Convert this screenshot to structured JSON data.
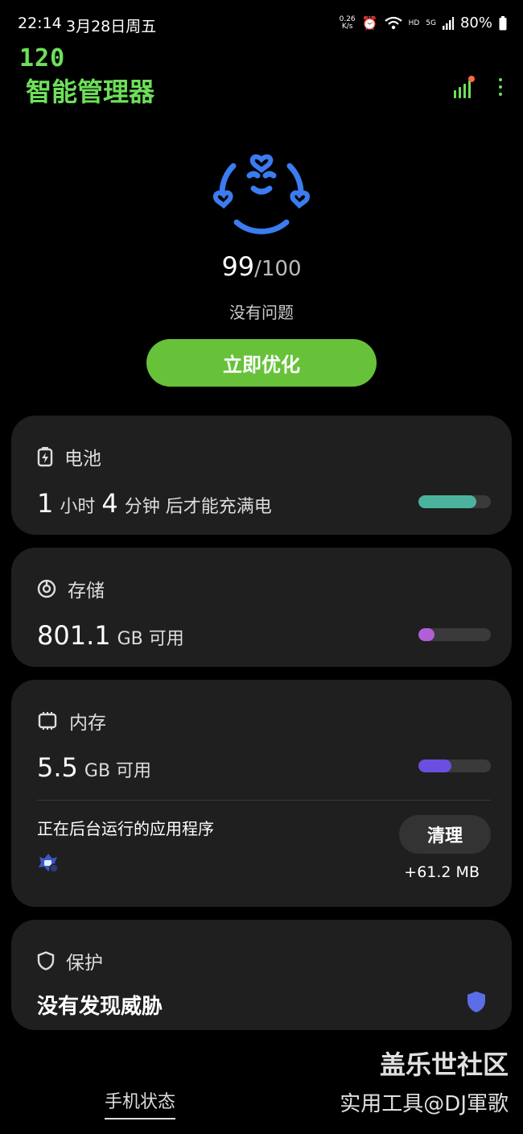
{
  "status_bar": {
    "time": "22:14",
    "date": "3月28日周五",
    "net_speed_value": "0.26",
    "net_speed_unit": "K/s",
    "hd": "HD",
    "network": "5G",
    "battery": "80%"
  },
  "overlay": {
    "fps": "120"
  },
  "header": {
    "title": "智能管理器"
  },
  "summary": {
    "score": "99",
    "score_max": "/100",
    "status": "没有问题",
    "optimize_label": "立即优化"
  },
  "battery_card": {
    "title": "电池",
    "hours": "1",
    "hours_unit": "小时",
    "minutes": "4",
    "minutes_unit": "分钟 后才能充满电",
    "level_fraction": 0.8,
    "bar_color": "#4bb39d"
  },
  "storage_card": {
    "title": "存储",
    "value": "801.1",
    "unit": "GB 可用",
    "level_fraction": 0.22,
    "bar_color": "#b15fd6"
  },
  "memory_card": {
    "title": "内存",
    "value": "5.5",
    "unit": "GB 可用",
    "level_fraction": 0.45,
    "bar_color": "#6a4fe0",
    "background_apps_title": "正在后台运行的应用程序",
    "clean_label": "清理",
    "freed": "+61.2 MB"
  },
  "protection_card": {
    "title": "保护",
    "status": "没有发现威胁",
    "shield_color": "#5b6ee8"
  },
  "bottom": {
    "tab_label": "手机状态"
  },
  "watermark": {
    "line1": "盖乐世社区",
    "line2": "实用工具@DJ軍歌"
  },
  "colors": {
    "accent_green": "#6ee05a",
    "button_green": "#67c23a",
    "face_blue": "#3b7cf0"
  }
}
